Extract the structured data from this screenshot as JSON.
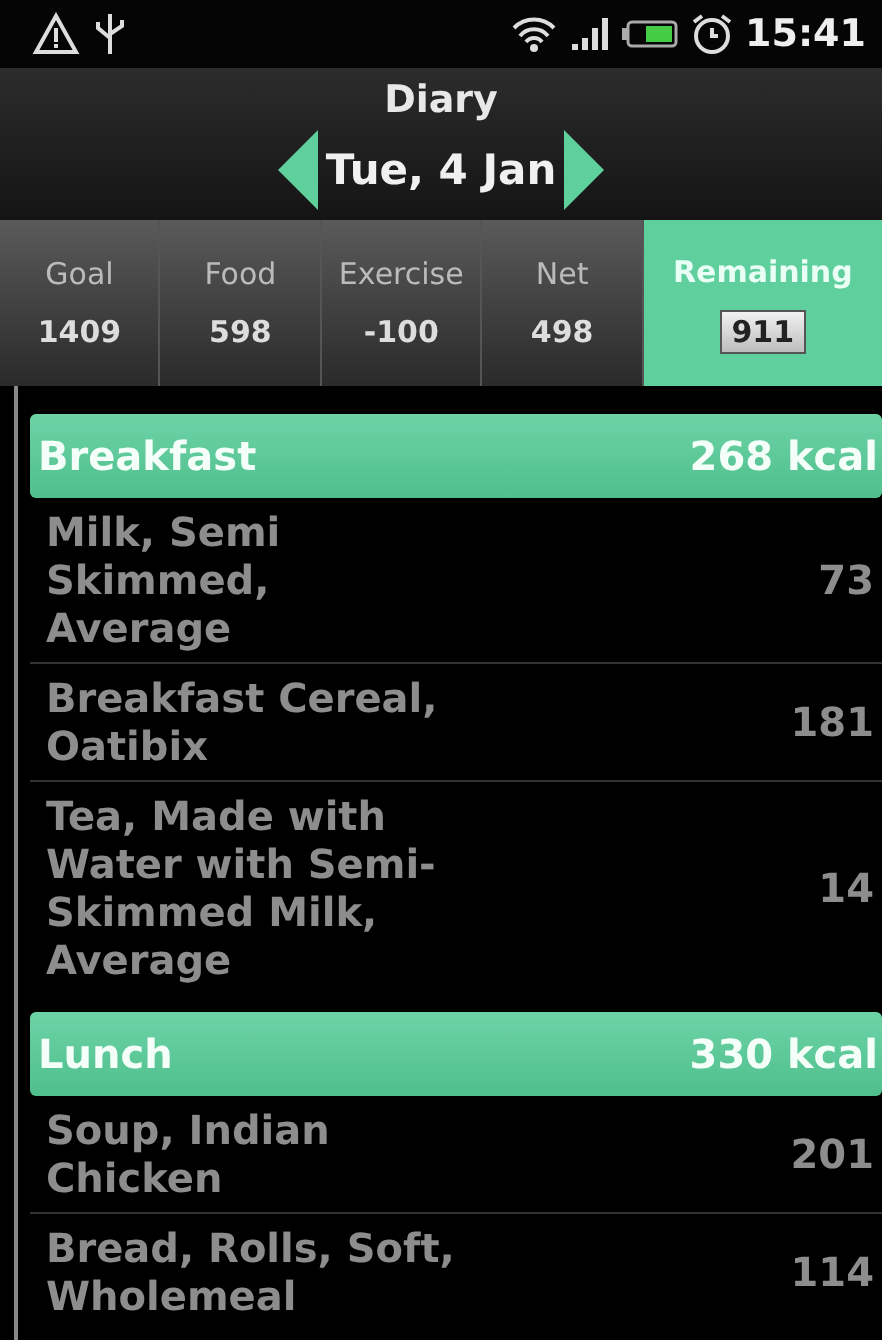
{
  "status_bar": {
    "time": "15:41"
  },
  "header": {
    "title": "Diary",
    "date": "Tue, 4 Jan"
  },
  "summary": [
    {
      "label": "Goal",
      "value": "1409",
      "selected": false
    },
    {
      "label": "Food",
      "value": "598",
      "selected": false
    },
    {
      "label": "Exercise",
      "value": "-100",
      "selected": false
    },
    {
      "label": "Net",
      "value": "498",
      "selected": false
    },
    {
      "label": "Remaining",
      "value": "911",
      "selected": true
    }
  ],
  "meals": [
    {
      "name": "Breakfast",
      "total": "268 kcal",
      "items": [
        {
          "name": "Milk, Semi\nSkimmed,\nAverage",
          "kcal": "73"
        },
        {
          "name": "Breakfast Cereal,\nOatibix",
          "kcal": "181"
        },
        {
          "name": "Tea, Made with\nWater with Semi-\nSkimmed Milk,\nAverage",
          "kcal": "14"
        }
      ]
    },
    {
      "name": "Lunch",
      "total": "330 kcal",
      "items": [
        {
          "name": "Soup, Indian\nChicken",
          "kcal": "201"
        },
        {
          "name": "Bread, Rolls, Soft,\nWholemeal",
          "kcal": "114"
        }
      ]
    }
  ]
}
